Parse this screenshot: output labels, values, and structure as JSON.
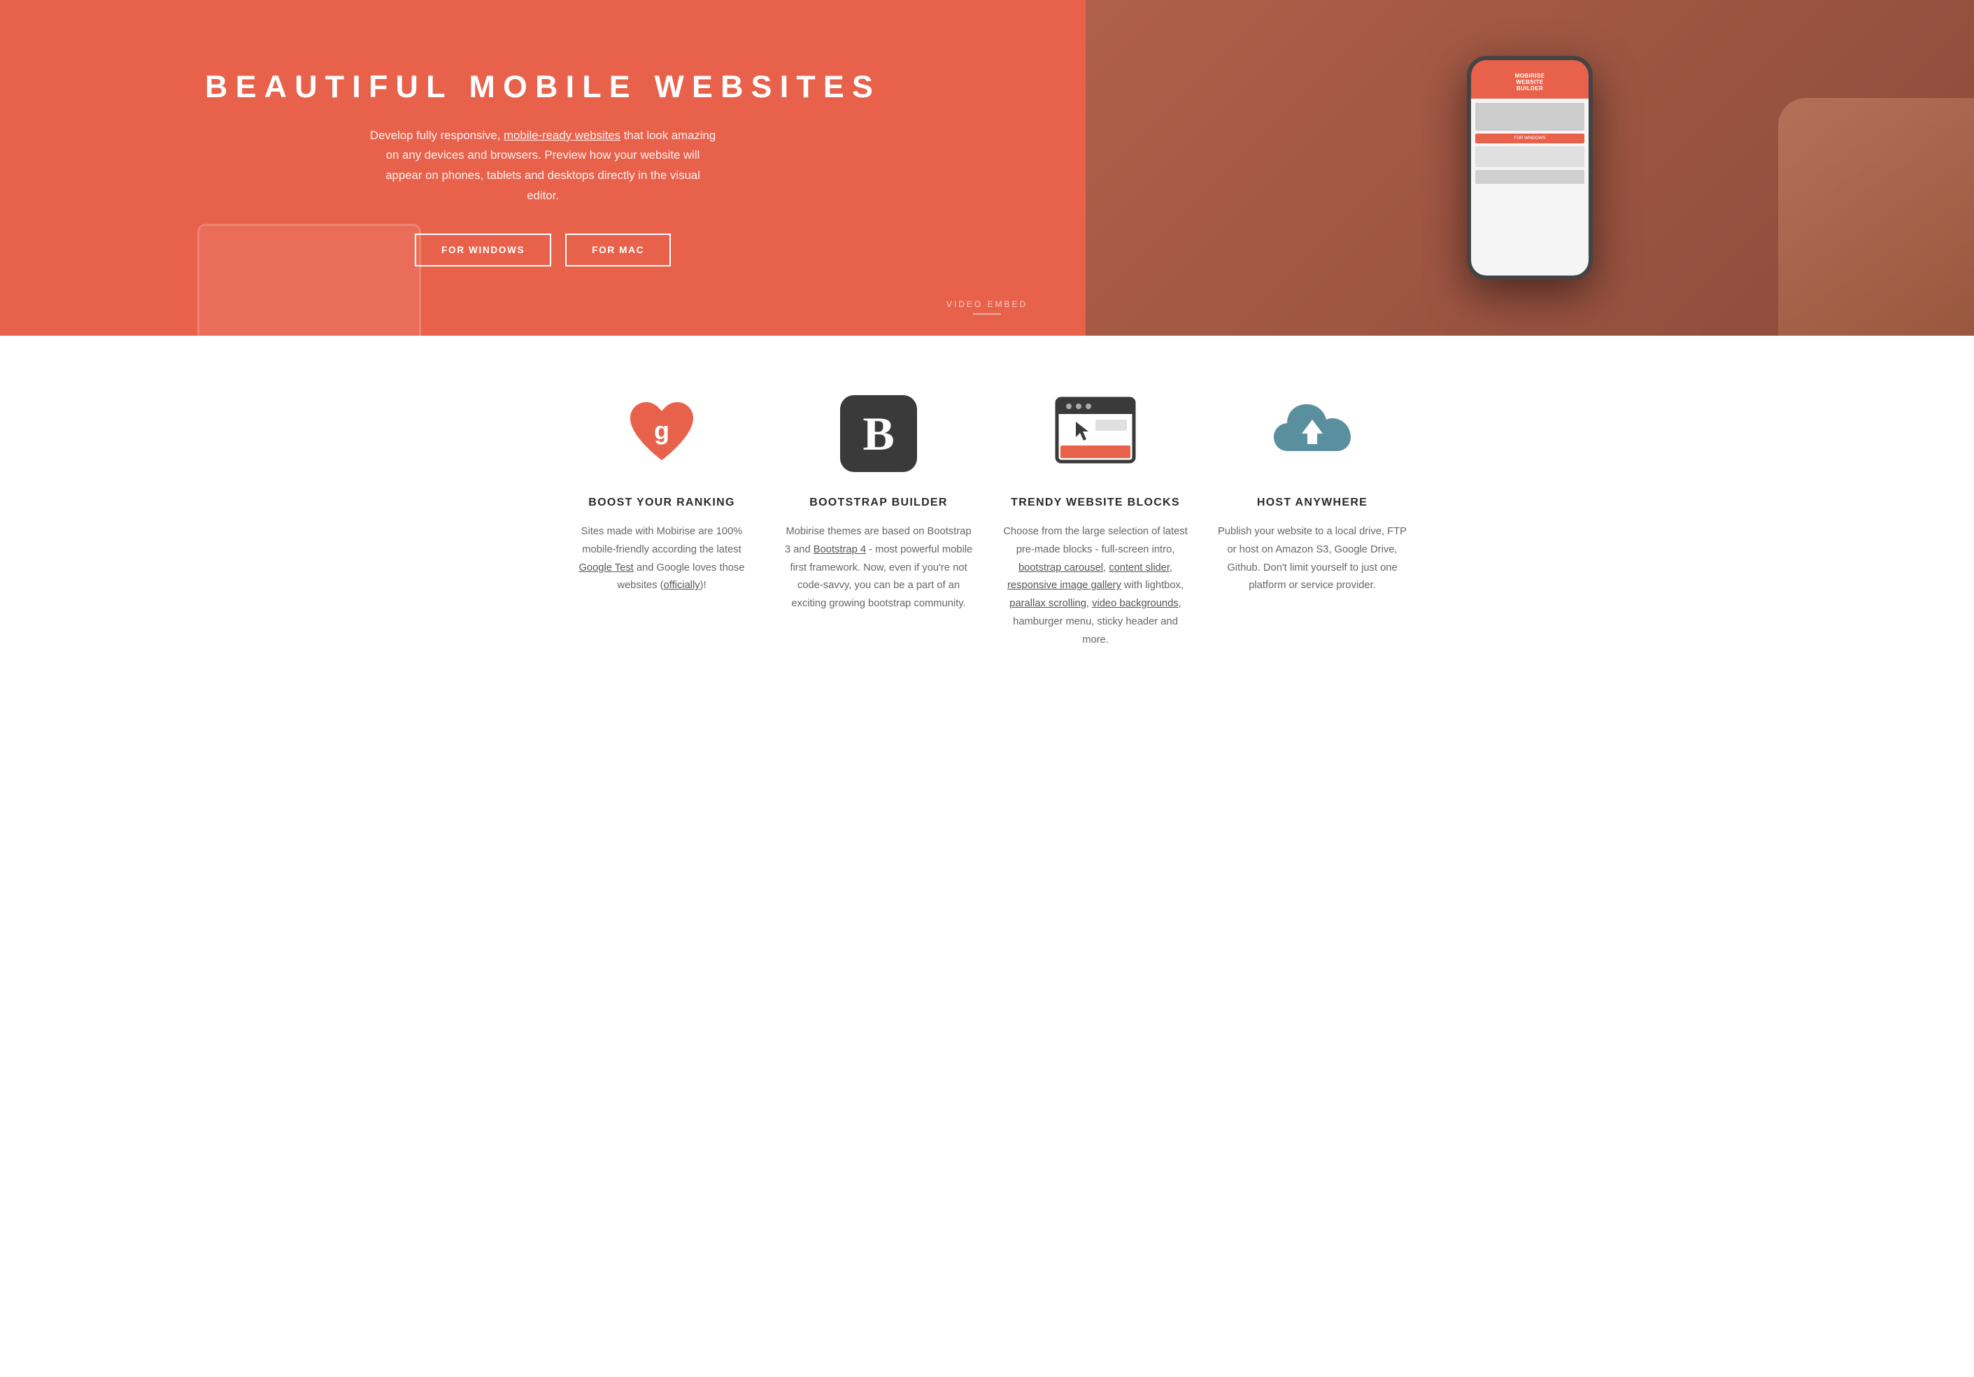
{
  "hero": {
    "title": "BEAUTIFUL MOBILE WEBSITES",
    "description_1": "Develop fully responsive, ",
    "description_link": "mobile-ready websites",
    "description_2": " that look amazing on any devices and browsers. Preview how your website will appear on phones, tablets and desktops directly in the visual editor.",
    "btn_windows": "FOR WINDOWS",
    "btn_mac": "FOR MAC",
    "video_label": "VIDEO EMBED",
    "phone_title_1": "MOBIRISE",
    "phone_title_2": "WEBSITE",
    "phone_title_3": "BUILDER"
  },
  "features": [
    {
      "icon": "heart-google",
      "title": "BOOST YOUR RANKING",
      "desc_parts": [
        {
          "text": "Sites made with Mobirise are 100% mobile-friendly according the latest "
        },
        {
          "text": "Google Test",
          "link": true
        },
        {
          "text": " and Google loves those websites ("
        },
        {
          "text": "officially",
          "link": true
        },
        {
          "text": ")!"
        }
      ]
    },
    {
      "icon": "bootstrap-b",
      "title": "BOOTSTRAP BUILDER",
      "desc_parts": [
        {
          "text": "Mobirise themes are based on Bootstrap 3 and "
        },
        {
          "text": "Bootstrap 4",
          "link": true
        },
        {
          "text": " - most powerful mobile first framework. Now, even if you're not code-savvy, you can be a part of an exciting growing bootstrap community."
        }
      ]
    },
    {
      "icon": "browser-blocks",
      "title": "TRENDY WEBSITE BLOCKS",
      "desc_parts": [
        {
          "text": "Choose from the large selection of latest pre-made blocks - full-screen intro, "
        },
        {
          "text": "bootstrap carousel",
          "link": true
        },
        {
          "text": ", "
        },
        {
          "text": "content slider",
          "link": true
        },
        {
          "text": ", "
        },
        {
          "text": "responsive image gallery",
          "link": true
        },
        {
          "text": " with lightbox, "
        },
        {
          "text": "parallax scrolling",
          "link": true
        },
        {
          "text": ", "
        },
        {
          "text": "video backgrounds",
          "link": true
        },
        {
          "text": ", hamburger menu, sticky header and more."
        }
      ]
    },
    {
      "icon": "cloud-upload",
      "title": "HOST ANYWHERE",
      "desc_parts": [
        {
          "text": "Publish your website to a local drive, FTP or host on Amazon S3, Google Drive, Github. Don't limit yourself to just one platform or service provider."
        }
      ]
    }
  ]
}
